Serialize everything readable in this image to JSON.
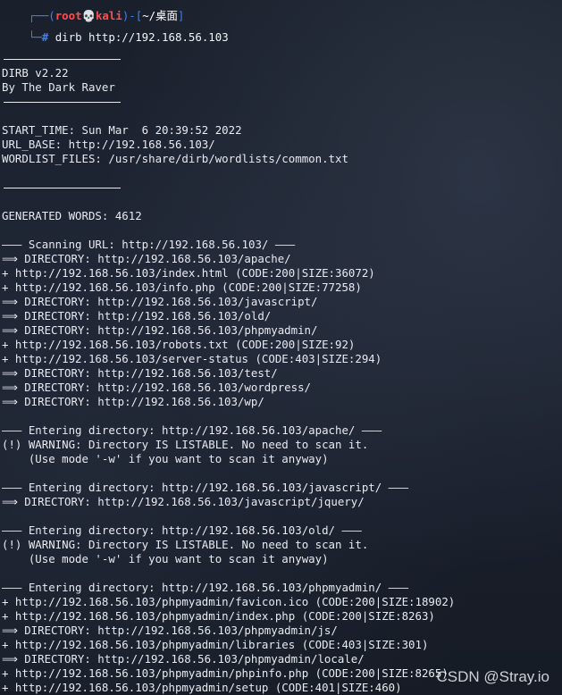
{
  "prompt": {
    "user": "root",
    "skull": "💀",
    "host": "kali",
    "dir": "~/桌面",
    "symbol": "#",
    "command": "dirb http://192.168.56.103"
  },
  "output": [
    "",
    "-----------------",
    "DIRB v2.22",
    "By The Dark Raver",
    "-----------------",
    "",
    "START_TIME: Sun Mar  6 20:39:52 2022",
    "URL_BASE: http://192.168.56.103/",
    "WORDLIST_FILES: /usr/share/dirb/wordlists/common.txt",
    "",
    "-----------------",
    "",
    "GENERATED WORDS: 4612",
    "",
    "---- Scanning URL: http://192.168.56.103/ ----",
    "==> DIRECTORY: http://192.168.56.103/apache/",
    "+ http://192.168.56.103/index.html (CODE:200|SIZE:36072)",
    "+ http://192.168.56.103/info.php (CODE:200|SIZE:77258)",
    "==> DIRECTORY: http://192.168.56.103/javascript/",
    "==> DIRECTORY: http://192.168.56.103/old/",
    "==> DIRECTORY: http://192.168.56.103/phpmyadmin/",
    "+ http://192.168.56.103/robots.txt (CODE:200|SIZE:92)",
    "+ http://192.168.56.103/server-status (CODE:403|SIZE:294)",
    "==> DIRECTORY: http://192.168.56.103/test/",
    "==> DIRECTORY: http://192.168.56.103/wordpress/",
    "==> DIRECTORY: http://192.168.56.103/wp/",
    "",
    "---- Entering directory: http://192.168.56.103/apache/ ----",
    "(!) WARNING: Directory IS LISTABLE. No need to scan it.",
    "    (Use mode '-w' if you want to scan it anyway)",
    "",
    "---- Entering directory: http://192.168.56.103/javascript/ ----",
    "==> DIRECTORY: http://192.168.56.103/javascript/jquery/",
    "",
    "---- Entering directory: http://192.168.56.103/old/ ----",
    "(!) WARNING: Directory IS LISTABLE. No need to scan it.",
    "    (Use mode '-w' if you want to scan it anyway)",
    "",
    "---- Entering directory: http://192.168.56.103/phpmyadmin/ ----",
    "+ http://192.168.56.103/phpmyadmin/favicon.ico (CODE:200|SIZE:18902)",
    "+ http://192.168.56.103/phpmyadmin/index.php (CODE:200|SIZE:8263)",
    "==> DIRECTORY: http://192.168.56.103/phpmyadmin/js/",
    "+ http://192.168.56.103/phpmyadmin/libraries (CODE:403|SIZE:301)",
    "==> DIRECTORY: http://192.168.56.103/phpmyadmin/locale/",
    "+ http://192.168.56.103/phpmyadmin/phpinfo.php (CODE:200|SIZE:8265)",
    "+ http://192.168.56.103/phpmyadmin/setup (CODE:401|SIZE:460)"
  ],
  "watermark": "CSDN @Stray.io"
}
